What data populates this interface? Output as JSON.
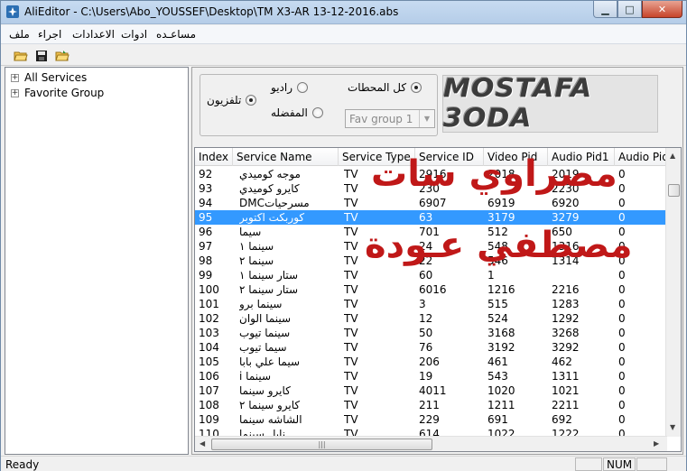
{
  "window": {
    "title": "AliEditor - C:\\Users\\Abo_YOUSSEF\\Desktop\\TM X3-AR 13-12-2016.abs",
    "minimize": "▁",
    "maximize": "□",
    "close": "✕"
  },
  "menu": {
    "file": "ملف",
    "action": "اجراء",
    "settings": "الاعدادات",
    "tools": "ادوات",
    "help": "مساعـده"
  },
  "toolbar": {
    "open_icon": "open-folder-icon",
    "save_icon": "save-disk-icon",
    "export_icon": "export-folder-icon"
  },
  "tree": {
    "items": [
      {
        "label": "All Services"
      },
      {
        "label": "Favorite Group"
      }
    ]
  },
  "filters": {
    "tv": "تلفزيون",
    "radio": "راديو",
    "all_channels": "كل المحطات",
    "favorites": "المفضله",
    "fav_group_value": "Fav group 1",
    "tv_checked": true,
    "all_checked": true
  },
  "logo": {
    "text": "MOSTAFA 3ODA"
  },
  "table": {
    "columns": [
      "Index",
      "Service Name",
      "Service Type",
      "Service ID",
      "Video Pid",
      "Audio Pid1",
      "Audio Pid"
    ],
    "selected_index": 3,
    "rows": [
      [
        "92",
        "موجه كوميدي",
        "TV",
        "2916",
        "2018",
        "2019",
        "0"
      ],
      [
        "93",
        "كايرو كوميدي",
        "TV",
        "230",
        "",
        "2230",
        "0"
      ],
      [
        "94",
        "مسرحياتDMC",
        "TV",
        "6907",
        "6919",
        "6920",
        "0"
      ],
      [
        "95",
        "كوربكت اكتوبر",
        "TV",
        "63",
        "3179",
        "3279",
        "0"
      ],
      [
        "96",
        "سيما",
        "TV",
        "701",
        "512",
        "650",
        "0"
      ],
      [
        "97",
        "سينما ١",
        "TV",
        "24",
        "548",
        "1316",
        "0"
      ],
      [
        "98",
        "سينما ٢",
        "TV",
        "22",
        "546",
        "1314",
        "0"
      ],
      [
        "99",
        "ستار سينما ١",
        "TV",
        "60",
        "1",
        "",
        "0"
      ],
      [
        "100",
        "ستار سينما ٢",
        "TV",
        "6016",
        "1216",
        "2216",
        "0"
      ],
      [
        "101",
        "سينما برو",
        "TV",
        "3",
        "515",
        "1283",
        "0"
      ],
      [
        "102",
        "سينما الوان",
        "TV",
        "12",
        "524",
        "1292",
        "0"
      ],
      [
        "103",
        "سينما تيوب",
        "TV",
        "50",
        "3168",
        "3268",
        "0"
      ],
      [
        "104",
        "سيما تيوب",
        "TV",
        "76",
        "3192",
        "3292",
        "0"
      ],
      [
        "105",
        "سيما علي بابا",
        "TV",
        "206",
        "461",
        "462",
        "0"
      ],
      [
        "106",
        "سينما i",
        "TV",
        "19",
        "543",
        "1311",
        "0"
      ],
      [
        "107",
        "كايرو سينما",
        "TV",
        "4011",
        "1020",
        "1021",
        "0"
      ],
      [
        "108",
        "كايرو سينما ٢",
        "TV",
        "211",
        "1211",
        "2211",
        "0"
      ],
      [
        "109",
        "الشاشه سينما",
        "TV",
        "229",
        "691",
        "692",
        "0"
      ],
      [
        "110",
        "نايل سينما",
        "TV",
        "614",
        "1022",
        "1222",
        "0"
      ]
    ]
  },
  "watermark": {
    "line1": "مصراوي سات",
    "line2": "مصطفي عـودة"
  },
  "status": {
    "text": "Ready",
    "num": "NUM"
  },
  "colors": {
    "selection": "#3399ff",
    "watermark": "#c01818"
  }
}
